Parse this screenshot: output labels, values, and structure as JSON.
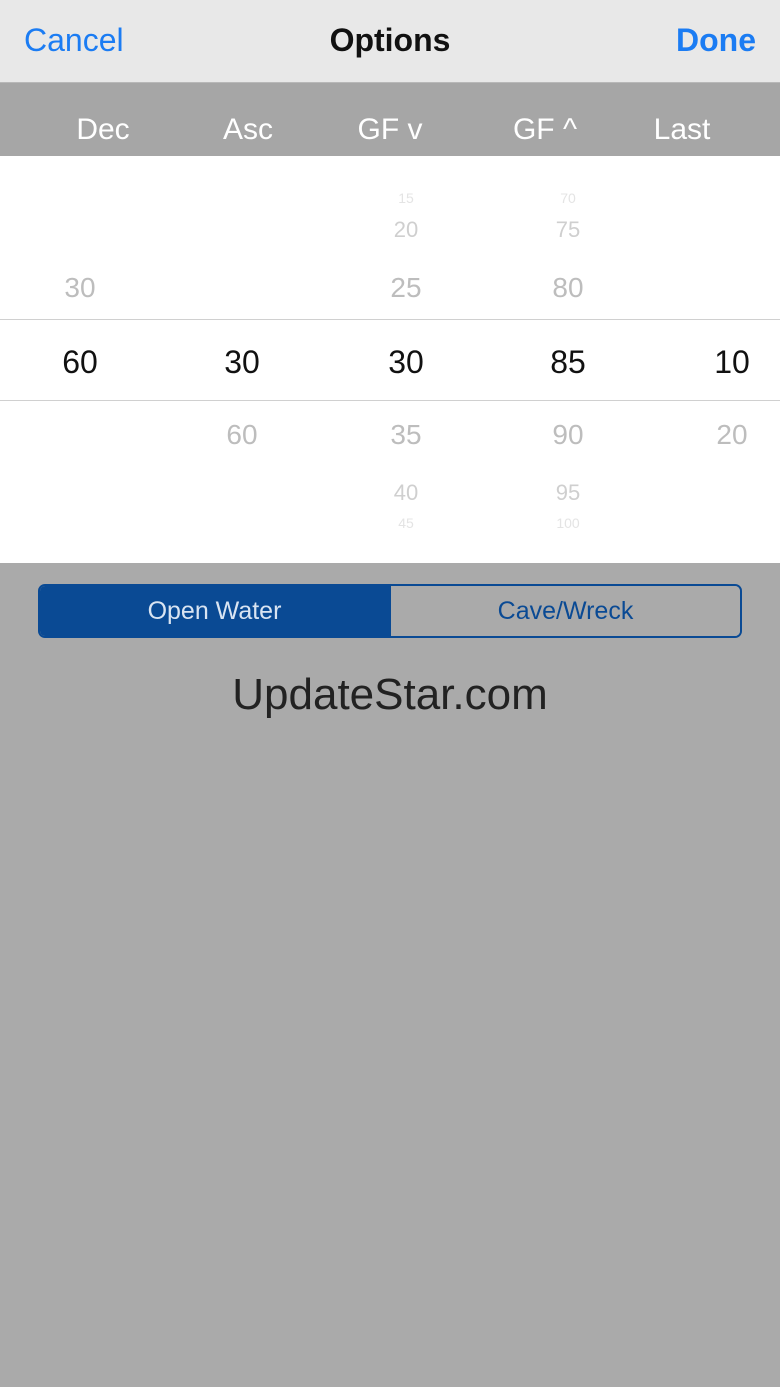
{
  "navbar": {
    "cancel_label": "Cancel",
    "title": "Options",
    "done_label": "Done"
  },
  "picker": {
    "headers": [
      "Dec",
      "Asc",
      "GF v",
      "GF ^",
      "Last"
    ],
    "columns": {
      "dec": {
        "above2": "",
        "above1": "30",
        "selected": "60",
        "below1": "",
        "below2": ""
      },
      "asc": {
        "above2": "",
        "above1": "",
        "selected": "30",
        "below1": "60",
        "below2": ""
      },
      "gfdown": {
        "above3": "15",
        "above2": "20",
        "above1": "25",
        "selected": "30",
        "below1": "35",
        "below2": "40",
        "below3": "45"
      },
      "gfup": {
        "above3": "70",
        "above2": "75",
        "above1": "80",
        "selected": "85",
        "below1": "90",
        "below2": "95",
        "below3": "100"
      },
      "last": {
        "above2": "",
        "above1": "",
        "selected": "10",
        "below1": "20",
        "below2": ""
      }
    }
  },
  "mode": {
    "open_water": "Open Water",
    "cave_wreck": "Cave/Wreck",
    "selected": "Open Water"
  },
  "watermark": "UpdateStar.com",
  "colors": {
    "accent": "#1b7cf3",
    "segment": "#0a4a94",
    "background": "#aaaaaa"
  }
}
